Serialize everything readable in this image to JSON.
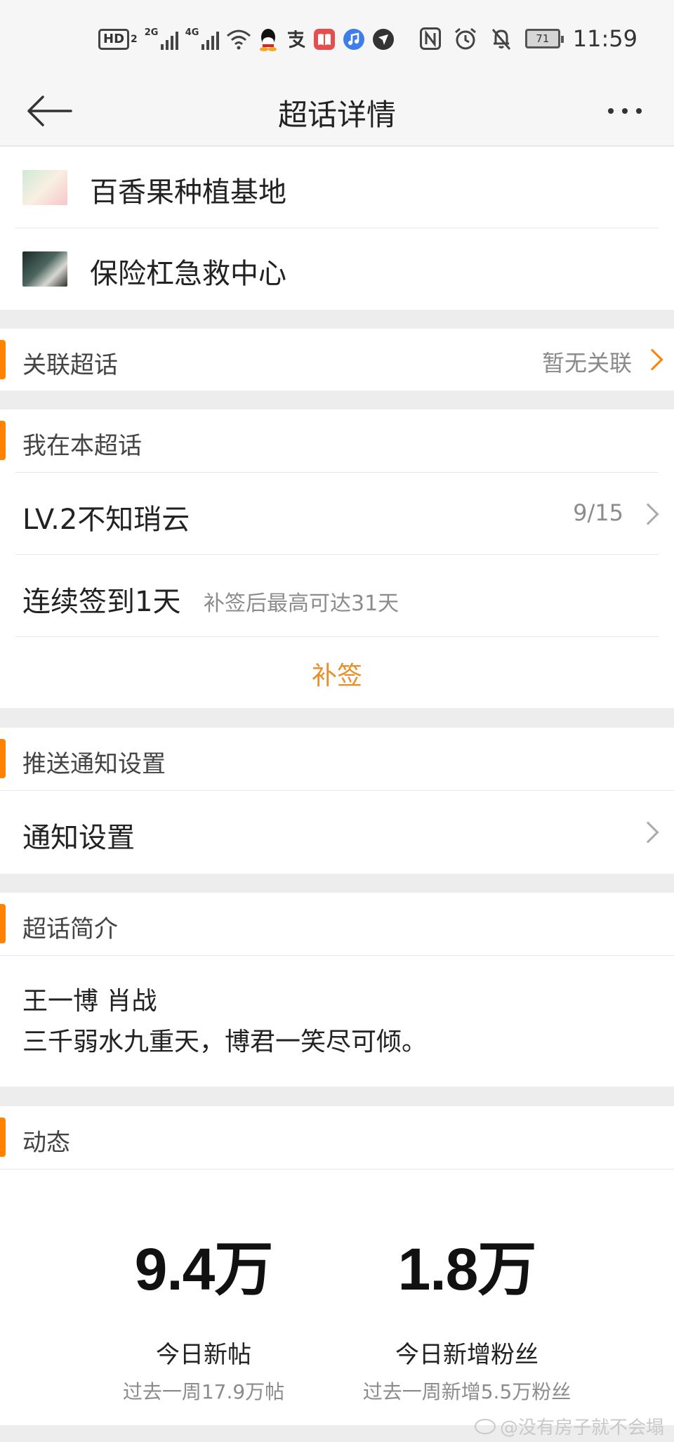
{
  "status_bar": {
    "hd": "HD",
    "hd_sub": "2",
    "net1": "2G",
    "net2": "4G",
    "battery": "71",
    "time": "11:59"
  },
  "nav": {
    "title": "超话详情"
  },
  "topics": [
    {
      "name": "百香果种植基地"
    },
    {
      "name": "保险杠急救中心"
    }
  ],
  "related": {
    "title": "关联超话",
    "value": "暂无关联"
  },
  "mine": {
    "title": "我在本超话",
    "level": "LV.2不知琑云",
    "progress": "9/15",
    "streak": "连续签到1天",
    "streak_hint": "补签后最高可达31天",
    "resign": "补签"
  },
  "push": {
    "title": "推送通知设置",
    "item": "通知设置"
  },
  "intro": {
    "title": "超话简介",
    "line1": "王一博 肖战",
    "line2": "三千弱水九重天，博君一笑尽可倾。"
  },
  "activity": {
    "title": "动态",
    "stats": [
      {
        "value": "9.4万",
        "label": "今日新帖",
        "sub": "过去一周17.9万帖"
      },
      {
        "value": "1.8万",
        "label": "今日新增粉丝",
        "sub": "过去一周新增5.5万粉丝"
      }
    ]
  },
  "watermark": "@没有房子就不会塌",
  "colors": {
    "accent": "#ff8200",
    "resign": "#e98f2a",
    "background": "#ededed"
  }
}
